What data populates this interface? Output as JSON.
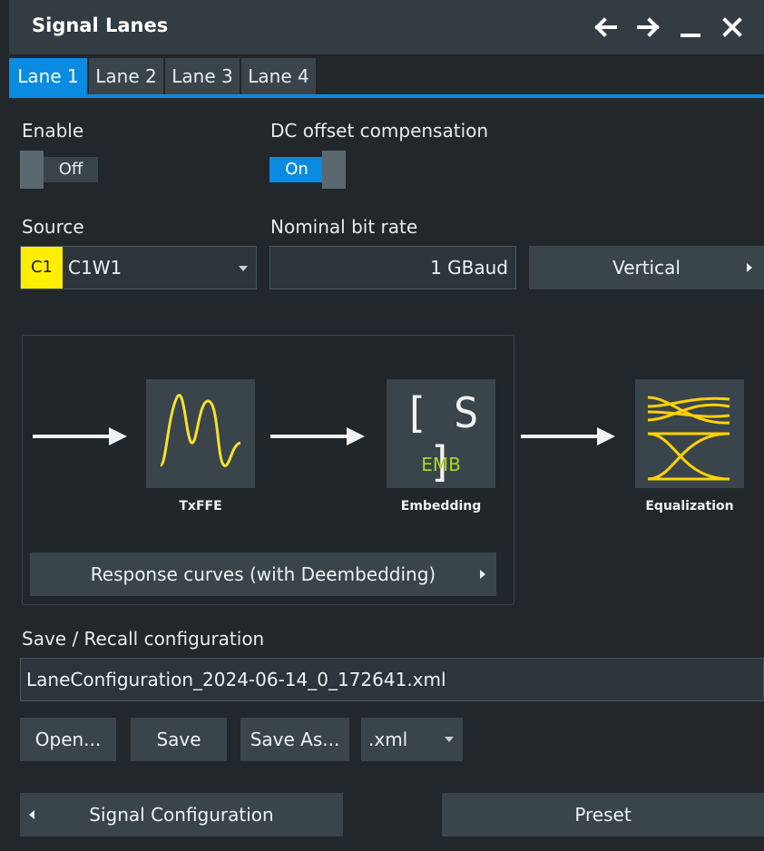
{
  "window": {
    "title": "Signal Lanes",
    "icons": [
      "arrow-left-icon",
      "arrow-right-icon",
      "minimize-icon",
      "close-icon"
    ]
  },
  "tabs": [
    {
      "label": "Lane 1",
      "active": true
    },
    {
      "label": "Lane 2",
      "active": false
    },
    {
      "label": "Lane 3",
      "active": false
    },
    {
      "label": "Lane 4",
      "active": false
    }
  ],
  "enable": {
    "label": "Enable",
    "state": "Off"
  },
  "dc_offset": {
    "label": "DC offset compensation",
    "state": "On"
  },
  "source": {
    "label": "Source",
    "badge": "C1",
    "value": "C1W1"
  },
  "bitrate": {
    "label": "Nominal bit rate",
    "value": "1 GBaud"
  },
  "vertical_button": "Vertical",
  "pipeline": {
    "txffe": "TxFFE",
    "embedding": "Embedding",
    "embedding_icon_text": "[ S ]",
    "embedding_sub": "EMB",
    "equalization": "Equalization",
    "response_button": "Response curves (with Deembedding)"
  },
  "save_recall": {
    "label": "Save / Recall configuration",
    "filename": "LaneConfiguration_2024-06-14_0_172641.xml",
    "open": "Open...",
    "save": "Save",
    "save_as": "Save As...",
    "format": ".xml"
  },
  "footer": {
    "signal_config": "Signal Configuration",
    "preset": "Preset"
  },
  "colors": {
    "accent": "#0a8be0",
    "channel_yellow": "#ffee00",
    "emb_green": "#a8d81a"
  }
}
